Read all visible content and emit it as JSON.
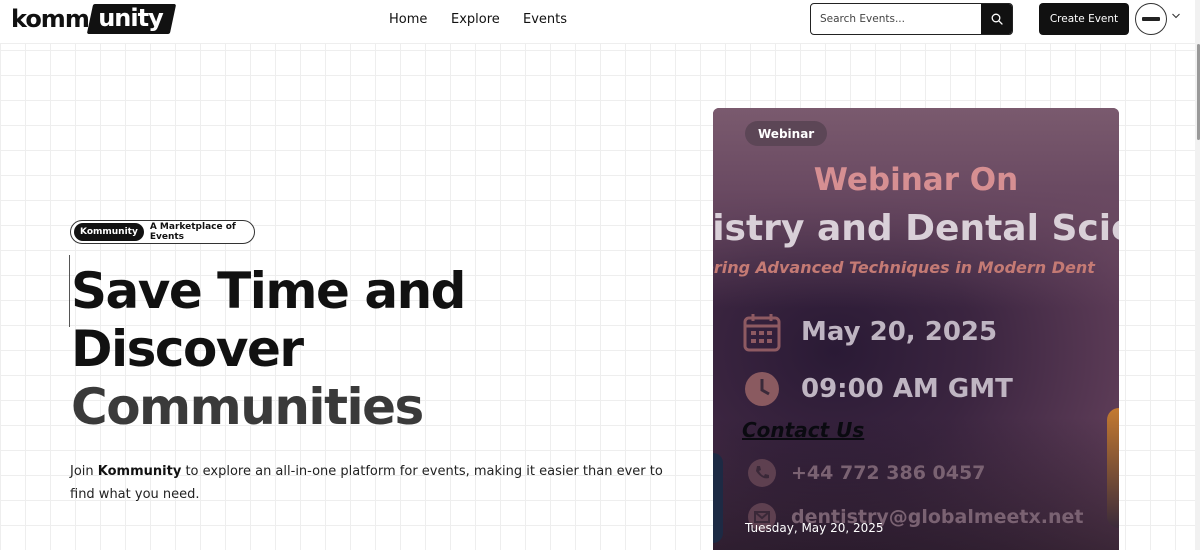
{
  "header": {
    "logo": {
      "part1": "komm",
      "part2": "unity"
    },
    "nav": [
      {
        "label": "Home"
      },
      {
        "label": "Explore"
      },
      {
        "label": "Events"
      }
    ],
    "search": {
      "placeholder": "Search Events...",
      "icon": "search-icon"
    },
    "create_button": "Create Event",
    "avatar_icon": "avatar",
    "chevron_icon": "chevron-down-icon"
  },
  "hero": {
    "pill_tag": "Kommunity",
    "pill_text": "A Marketplace of Events",
    "headline_1": "Save Time and",
    "headline_2": "Discover",
    "headline_3": "Communities",
    "desc_pre": "Join ",
    "desc_brand": "Kommunity",
    "desc_post": " to explore an all-in-one platform for events, making it easier than ever to find what you need."
  },
  "event_card": {
    "badge": "Webinar",
    "poster": {
      "title_1": "Webinar On",
      "title_2": "tistry and Dental Scie",
      "subtitle": "ering Advanced Techniques in Modern Dent",
      "date": "May 20, 2025",
      "time": "09:00 AM GMT",
      "contact": "Contact Us",
      "phone": "+44 772 386 0457",
      "email": "dentistry@globalmeetx.net"
    },
    "date": "Tuesday, May 20, 2025"
  }
}
